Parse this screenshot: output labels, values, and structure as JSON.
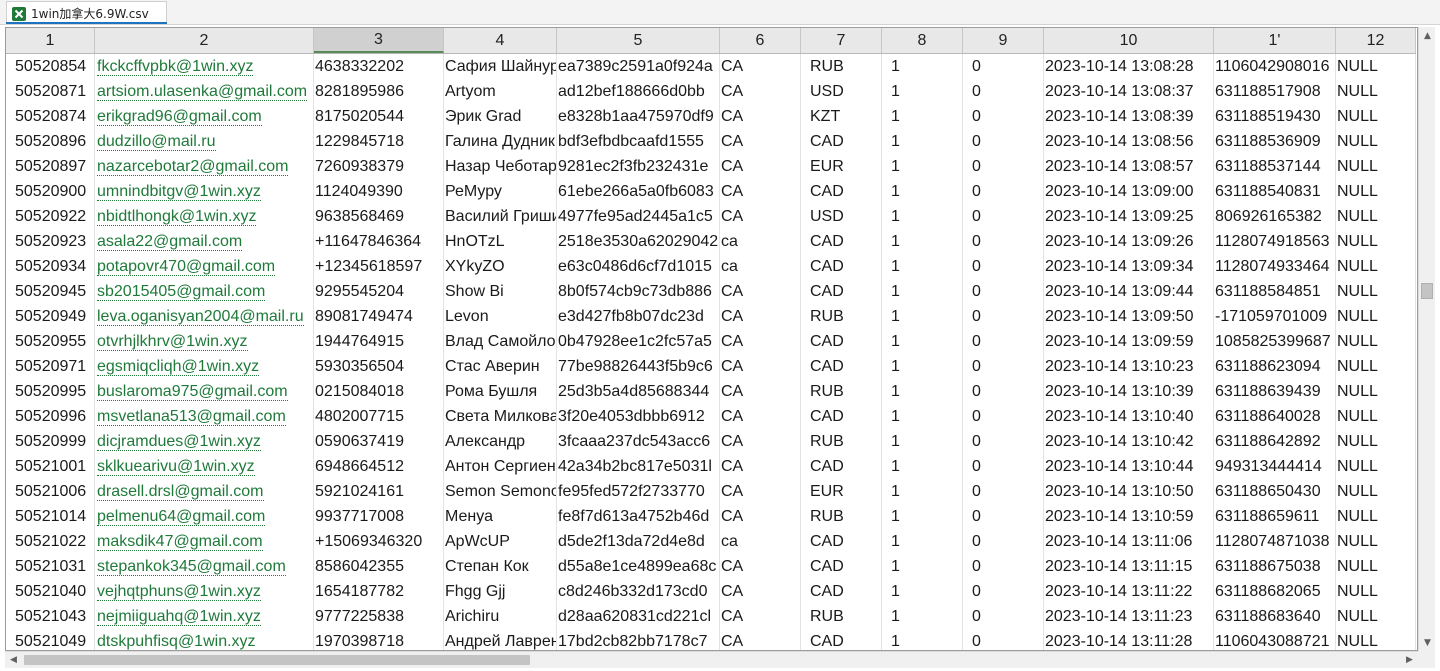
{
  "tab": {
    "title": "1win加拿大6.9W.csv",
    "icon": "excel-csv-icon"
  },
  "columns": [
    "1",
    "2",
    "3",
    "4",
    "5",
    "6",
    "7",
    "8",
    "9",
    "10",
    "1'",
    "12"
  ],
  "selected_column": "3",
  "rows": [
    [
      "50520854",
      "fkckcffvpbk@1win.xyz",
      "4638332202",
      "Сафия Шайнур",
      "ea7389c2591a0f924a",
      "CA",
      "RUB",
      "1",
      "0",
      "2023-10-14 13:08:28",
      "1106042908016",
      "NULL"
    ],
    [
      "50520871",
      "artsiom.ulasenka@gmail.com",
      "8281895986",
      "Artyom",
      "ad12bef188666d0bb",
      "CA",
      "USD",
      "1",
      "0",
      "2023-10-14 13:08:37",
      "631188517908",
      "NULL"
    ],
    [
      "50520874",
      "erikgrad96@gmail.com",
      "8175020544",
      "Эрик Grad",
      "e8328b1aa475970df9",
      "CA",
      "KZT",
      "1",
      "0",
      "2023-10-14 13:08:39",
      "631188519430",
      "NULL"
    ],
    [
      "50520896",
      "dudzillo@mail.ru",
      "1229845718",
      "Галина Дудник",
      "bdf3efbdbcaafd1555",
      "CA",
      "CAD",
      "1",
      "0",
      "2023-10-14 13:08:56",
      "631188536909",
      "NULL"
    ],
    [
      "50520897",
      "nazarcebotar2@gmail.com",
      "7260938379",
      "Назар Чеботарь",
      "9281ec2f3fb232431e",
      "CA",
      "EUR",
      "1",
      "0",
      "2023-10-14 13:08:57",
      "631188537144",
      "NULL"
    ],
    [
      "50520900",
      "umnindbitgv@1win.xyz",
      "1124049390",
      "РеМуру",
      "61ebe266a5a0fb6083",
      "CA",
      "CAD",
      "1",
      "0",
      "2023-10-14 13:09:00",
      "631188540831",
      "NULL"
    ],
    [
      "50520922",
      "nbidtlhongk@1win.xyz",
      "9638568469",
      "Василий Гришин",
      "4977fe95ad2445a1c5",
      "CA",
      "USD",
      "1",
      "0",
      "2023-10-14 13:09:25",
      "806926165382",
      "NULL"
    ],
    [
      "50520923",
      "asala22@gmail.com",
      "+11647846364",
      "HnOTzL",
      "2518e3530a62029042",
      "ca",
      "CAD",
      "1",
      "0",
      "2023-10-14 13:09:26",
      "1128074918563",
      "NULL"
    ],
    [
      "50520934",
      "potapovr470@gmail.com",
      "+12345618597",
      "XYkyZO",
      "e63c0486d6cf7d1015",
      "ca",
      "CAD",
      "1",
      "0",
      "2023-10-14 13:09:34",
      "1128074933464",
      "NULL"
    ],
    [
      "50520945",
      "sb2015405@gmail.com",
      "9295545204",
      "Show Bi",
      "8b0f574cb9c73db886",
      "CA",
      "CAD",
      "1",
      "0",
      "2023-10-14 13:09:44",
      "631188584851",
      "NULL"
    ],
    [
      "50520949",
      "leva.oganisyan2004@mail.ru",
      "89081749474",
      "Levon",
      "e3d427fb8b07dc23d",
      "CA",
      "RUB",
      "1",
      "0",
      "2023-10-14 13:09:50",
      "-171059701009",
      "NULL"
    ],
    [
      "50520955",
      "otvrhjlkhrv@1win.xyz",
      "1944764915",
      "Влад Самойлов",
      "0b47928ee1c2fc57a5",
      "CA",
      "CAD",
      "1",
      "0",
      "2023-10-14 13:09:59",
      "1085825399687",
      "NULL"
    ],
    [
      "50520971",
      "egsmiqcliqh@1win.xyz",
      "5930356504",
      "Стас Аверин",
      "77be98826443f5b9c6",
      "CA",
      "CAD",
      "1",
      "0",
      "2023-10-14 13:10:23",
      "631188623094",
      "NULL"
    ],
    [
      "50520995",
      "buslaroma975@gmail.com",
      "0215084018",
      "Рома Бушля",
      "25d3b5a4d85688344",
      "CA",
      "RUB",
      "1",
      "0",
      "2023-10-14 13:10:39",
      "631188639439",
      "NULL"
    ],
    [
      "50520996",
      "msvetlana513@gmail.com",
      "4802007715",
      "Света Милкова",
      "3f20e4053dbbb6912",
      "CA",
      "CAD",
      "1",
      "0",
      "2023-10-14 13:10:40",
      "631188640028",
      "NULL"
    ],
    [
      "50520999",
      "dicjramdues@1win.xyz",
      "0590637419",
      "Александр",
      "3fcaaa237dc543acc6",
      "CA",
      "RUB",
      "1",
      "0",
      "2023-10-14 13:10:42",
      "631188642892",
      "NULL"
    ],
    [
      "50521001",
      "sklkuearivu@1win.xyz",
      "6948664512",
      "Антон Сергиенко",
      "42a34b2bc817e5031l",
      "CA",
      "CAD",
      "1",
      "0",
      "2023-10-14 13:10:44",
      "949313444414",
      "NULL"
    ],
    [
      "50521006",
      "drasell.drsl@gmail.com",
      "5921024161",
      "Semon Semonov",
      "fe95fed572f2733770",
      "CA",
      "EUR",
      "1",
      "0",
      "2023-10-14 13:10:50",
      "631188650430",
      "NULL"
    ],
    [
      "50521014",
      "pelmenu64@gmail.com",
      "9937717008",
      "Менуа",
      "fe8f7d613a4752b46d",
      "CA",
      "RUB",
      "1",
      "0",
      "2023-10-14 13:10:59",
      "631188659611",
      "NULL"
    ],
    [
      "50521022",
      "maksdik47@gmail.com",
      "+15069346320",
      "ApWcUP",
      "d5de2f13da72d4e8d",
      "ca",
      "CAD",
      "1",
      "0",
      "2023-10-14 13:11:06",
      "1128074871038",
      "NULL"
    ],
    [
      "50521031",
      "stepankok345@gmail.com",
      "8586042355",
      "Степан Кок",
      "d55a8e1ce4899ea68c",
      "CA",
      "CAD",
      "1",
      "0",
      "2023-10-14 13:11:15",
      "631188675038",
      "NULL"
    ],
    [
      "50521040",
      "vejhqtphuns@1win.xyz",
      "1654187782",
      "Fhgg Gjj",
      "c8d246b332d173cd0",
      "CA",
      "CAD",
      "1",
      "0",
      "2023-10-14 13:11:22",
      "631188682065",
      "NULL"
    ],
    [
      "50521043",
      "nejmiiguahq@1win.xyz",
      "9777225838",
      "Arichiru",
      "d28aa620831cd221cl",
      "CA",
      "RUB",
      "1",
      "0",
      "2023-10-14 13:11:23",
      "631188683640",
      "NULL"
    ],
    [
      "50521049",
      "dtskpuhfisq@1win.xyz",
      "1970398718",
      "Андрей Лаврентьев",
      "17bd2cb82bb7178c7",
      "CA",
      "CAD",
      "1",
      "0",
      "2023-10-14 13:11:28",
      "1106043088721",
      "NULL"
    ]
  ]
}
